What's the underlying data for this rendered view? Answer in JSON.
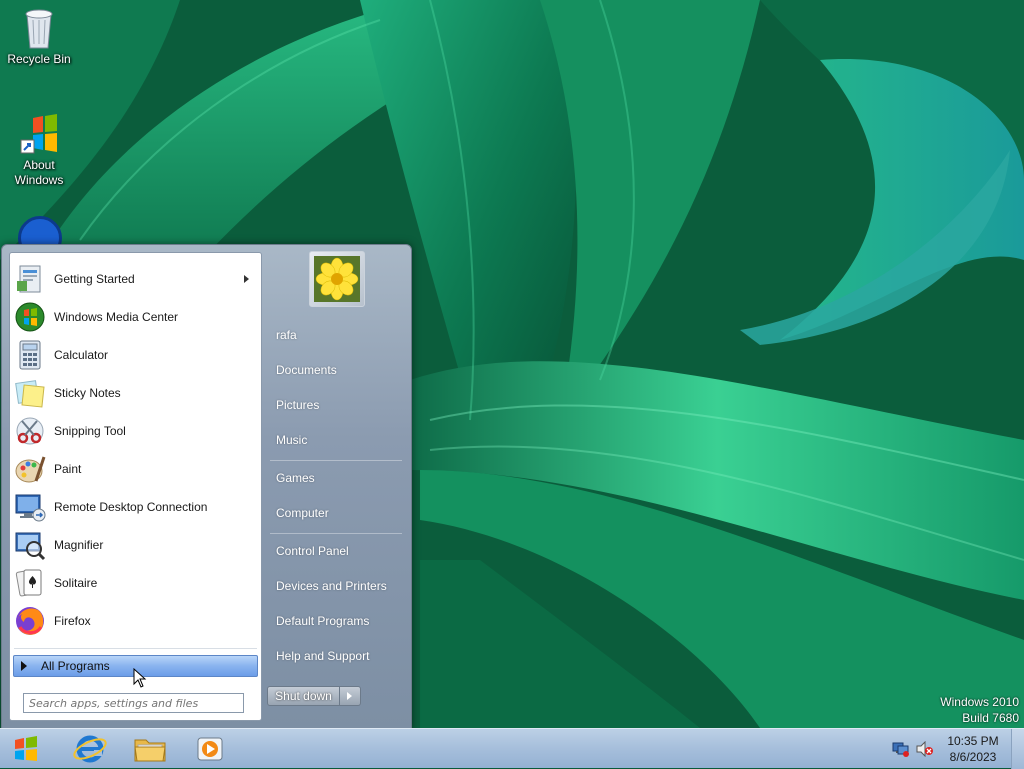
{
  "desktop": {
    "icons": [
      {
        "label": "Recycle Bin",
        "icon": "recycle-bin-icon"
      },
      {
        "label": "About\nWindows",
        "icon": "windows-logo-icon"
      }
    ]
  },
  "start_menu": {
    "programs": [
      {
        "label": "Getting Started",
        "icon": "getting-started-icon",
        "has_submenu": true
      },
      {
        "label": "Windows Media Center",
        "icon": "media-center-icon"
      },
      {
        "label": "Calculator",
        "icon": "calculator-icon"
      },
      {
        "label": "Sticky Notes",
        "icon": "sticky-notes-icon"
      },
      {
        "label": "Snipping Tool",
        "icon": "scissors-icon"
      },
      {
        "label": "Paint",
        "icon": "paint-palette-icon"
      },
      {
        "label": "Remote Desktop Connection",
        "icon": "remote-desktop-icon"
      },
      {
        "label": "Magnifier",
        "icon": "magnifier-icon"
      },
      {
        "label": "Solitaire",
        "icon": "playing-card-icon"
      },
      {
        "label": "Firefox",
        "icon": "firefox-icon"
      }
    ],
    "all_programs_label": "All Programs",
    "search_placeholder": "Search apps, settings and files",
    "right_pane": {
      "user": "rafa",
      "items_group1": [
        "Documents",
        "Pictures",
        "Music"
      ],
      "items_group2": [
        "Games",
        "Computer"
      ],
      "items_group3": [
        "Control Panel",
        "Devices and Printers",
        "Default Programs",
        "Help and Support"
      ]
    },
    "shutdown_label": "Shut down"
  },
  "watermark": {
    "line1": "Windows 2010",
    "line2": "Build 7680"
  },
  "taskbar": {
    "pinned": [
      "internet-explorer-icon",
      "file-explorer-icon",
      "media-player-icon"
    ],
    "clock_time": "10:35 PM",
    "clock_date": "8/6/2023",
    "tray_icons": [
      "network-icon",
      "volume-muted-icon"
    ]
  },
  "colors": {
    "taskbar": "#a8c0dc",
    "all_programs_highlight": "#89b3ef",
    "wallpaper_base": "#0b5d3c"
  }
}
